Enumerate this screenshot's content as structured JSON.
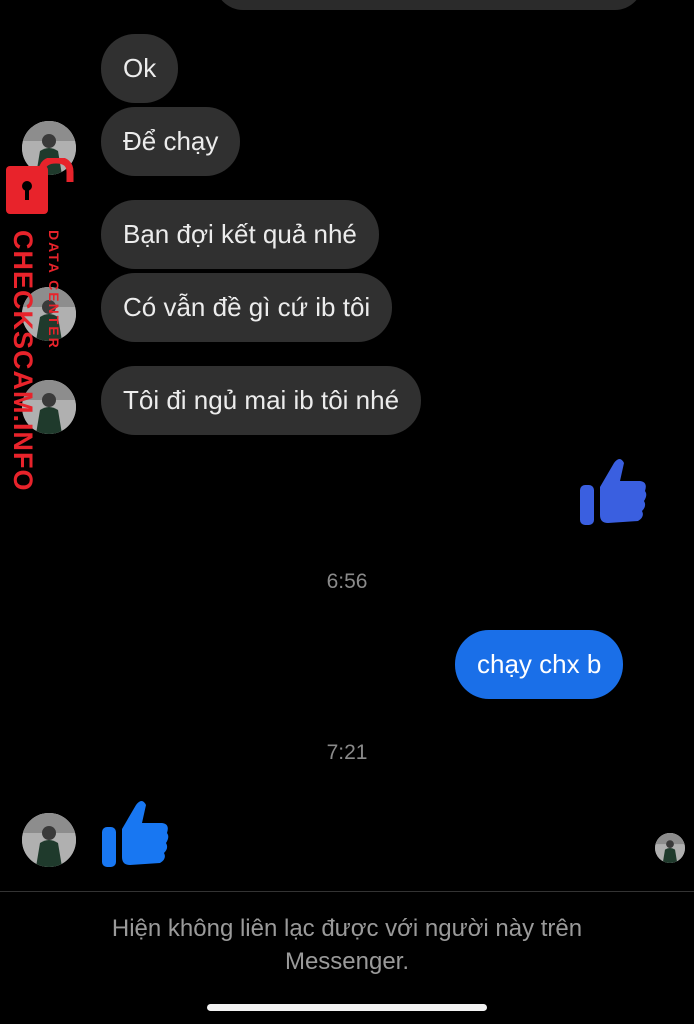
{
  "messages": {
    "incoming": [
      {
        "text": "Ok"
      },
      {
        "text": "Để chạy"
      },
      {
        "text": "Bạn đợi kết quả nhé"
      },
      {
        "text": "Có vẫn đề gì cứ ib tôi"
      },
      {
        "text": "Tôi đi ngủ mai ib tôi nhé"
      }
    ],
    "outgoing": [
      {
        "text": "chạy chx b"
      }
    ],
    "reactions": {
      "outgoing_like_icon": "thumbs-up-icon",
      "incoming_like_icon": "thumbs-up-icon"
    }
  },
  "timestamps": [
    "6:56",
    "7:21"
  ],
  "footer": {
    "notice": "Hiện không liên lạc được với người này trên Messenger."
  },
  "watermark": {
    "main": "CHECKSCAM.INFO",
    "sub": "DATA CENTER",
    "icon": "padlock-icon"
  },
  "colors": {
    "background": "#000000",
    "incoming_bubble": "#303030",
    "outgoing_bubble": "#1a6fe8",
    "like_outgoing": "#3a5fe0",
    "like_incoming": "#1877f2",
    "watermark": "#e8232b"
  }
}
